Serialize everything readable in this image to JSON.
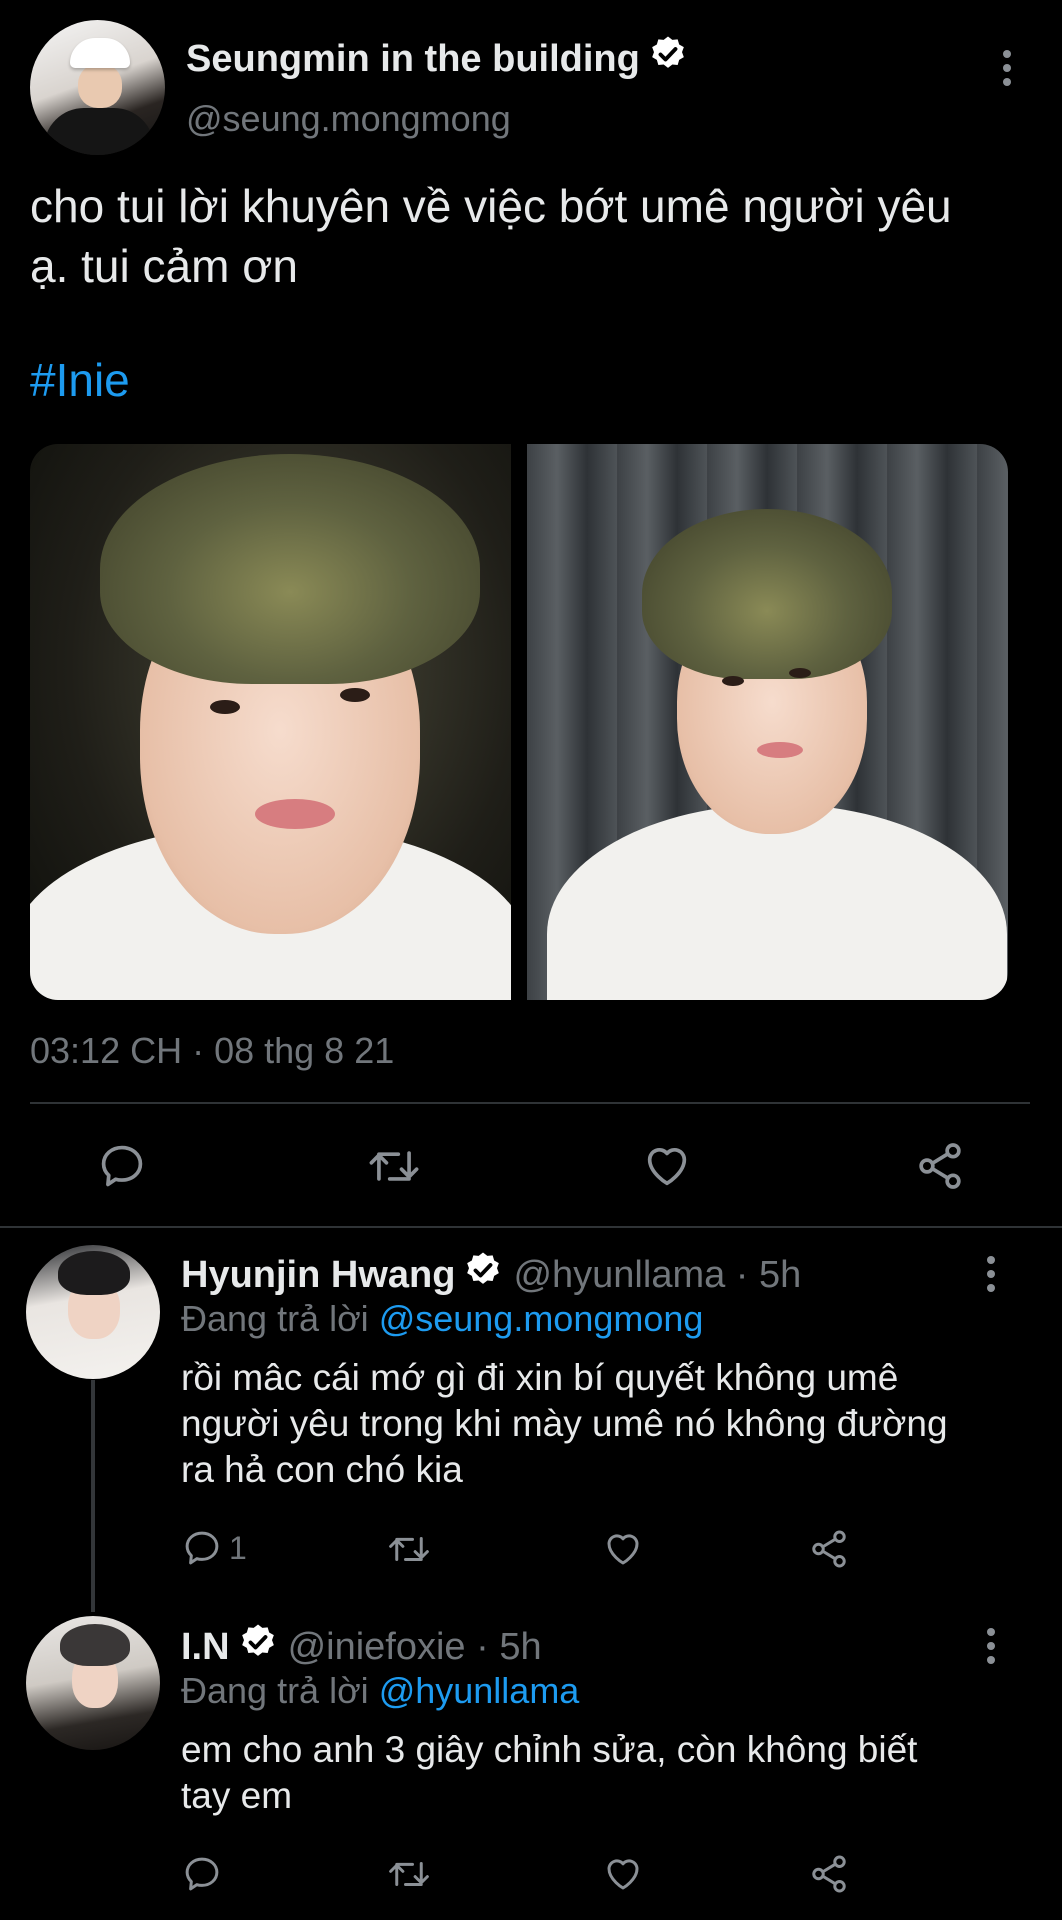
{
  "main_tweet": {
    "display_name": "Seungmin in the building",
    "handle": "@seung.mongmong",
    "text": "cho tui lời khuyên về việc bớt umê người yêu\nạ. tui cảm ơn",
    "hashtag": "#Inie",
    "timestamp": "03:12 CH · 08 thg 8 21",
    "icons": {
      "reply": "reply-icon",
      "retweet": "retweet-icon",
      "like": "heart-icon",
      "share": "share-icon",
      "more": "more-icon",
      "verified": "verified-badge-icon"
    }
  },
  "replies": [
    {
      "display_name": "Hyunjin Hwang",
      "handle_time": "@hyunllama · 5h",
      "replying_prefix": "Đang trả lời ",
      "replying_to": "@seung.mongmong",
      "text": "rồi mâc cái mớ gì đi xin bí quyết không umê\nngười yêu trong khi mày umê nó không đường\nra hả con chó kia",
      "reply_count": "1"
    },
    {
      "display_name": "I.N",
      "handle_time": "@iniefoxie · 5h",
      "replying_prefix": "Đang trả lời ",
      "replying_to": "@hyunllama",
      "text": "em cho anh 3 giây chỉnh sửa, còn không biết\ntay em",
      "reply_count": ""
    }
  ],
  "colors": {
    "background": "#000000",
    "text": "#e7e9ea",
    "secondary": "#71767b",
    "accent": "#1d9bf0",
    "divider": "#2f3336"
  }
}
